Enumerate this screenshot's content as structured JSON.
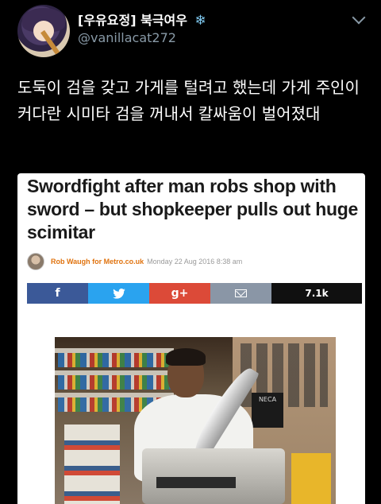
{
  "user": {
    "display_name": "[우유요정] 북극여우",
    "badge_icon": "snowflake-icon",
    "handle": "@vanillacat272"
  },
  "tweet": {
    "text": "도둑이 검을 갖고 가게를 털려고 했는데 가게 주인이 커다란 시미타 검을 꺼내서 칼싸움이 벌어졌대"
  },
  "article": {
    "headline": "Swordfight after man robs shop with sword – but shopkeeper pulls out huge scimitar",
    "author": "Rob Waugh for Metro.co.uk",
    "date": "Monday 22 Aug 2016 8:38 am",
    "share": {
      "facebook": "f",
      "twitter_icon": "twitter-bird-icon",
      "google_plus": "g+",
      "email_icon": "mail-icon",
      "count": "7.1k"
    },
    "photo_sign": "NECA"
  },
  "colors": {
    "background": "#000000",
    "handle": "#8899a6",
    "byline_author": "#e0730f",
    "facebook": "#3b5998",
    "twitter": "#2aa3ef",
    "google_plus": "#dc4a38"
  }
}
